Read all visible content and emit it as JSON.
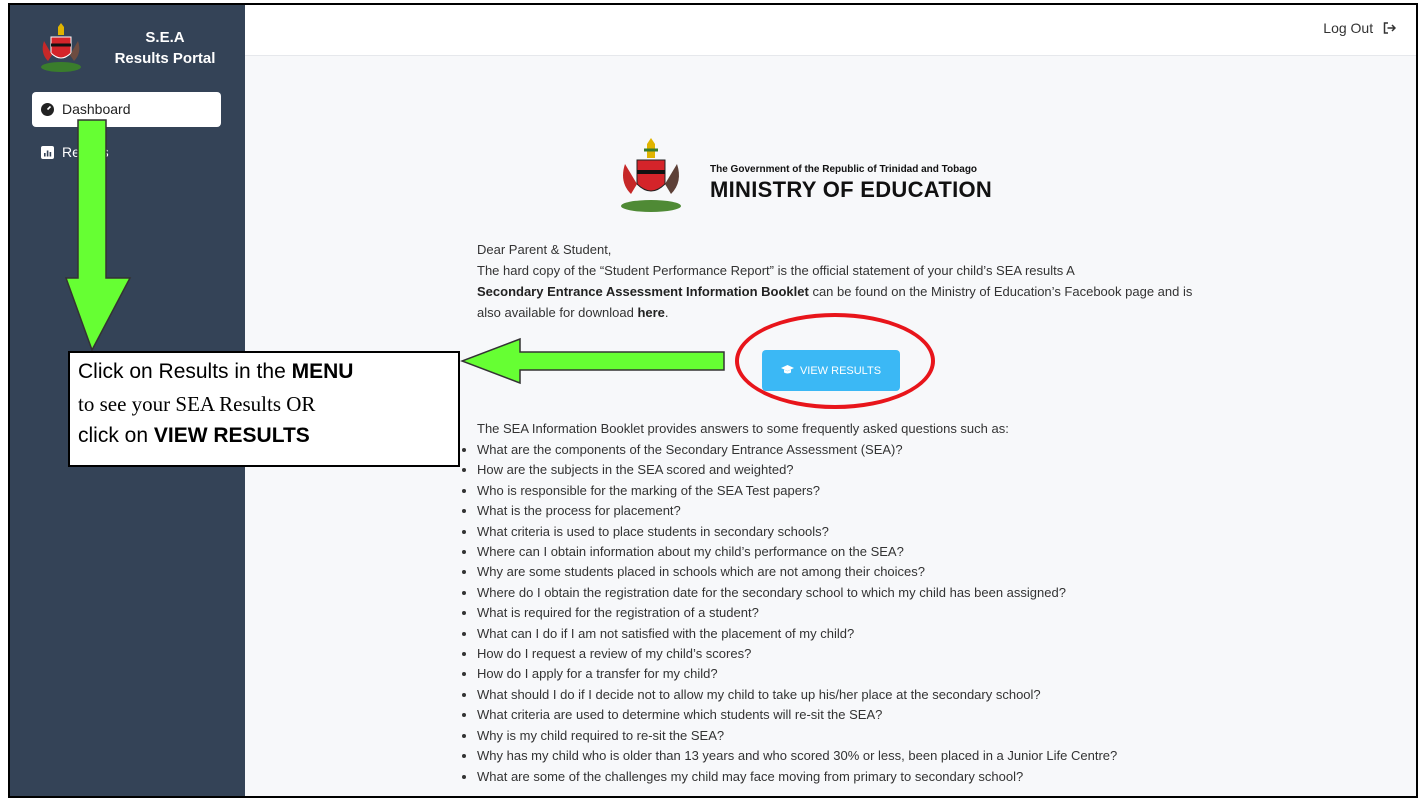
{
  "sidebar": {
    "brand_line1": "S.E.A",
    "brand_line2": "Results Portal",
    "items": [
      {
        "label": "Dashboard",
        "icon": "dashboard-icon",
        "active": true
      },
      {
        "label": "Results",
        "icon": "chart-icon",
        "active": false
      }
    ]
  },
  "topbar": {
    "logout_label": "Log Out",
    "logout_icon": "logout-icon"
  },
  "header": {
    "subtitle": "The Government of the Republic of Trinidad and Tobago",
    "title": "MINISTRY OF EDUCATION"
  },
  "letter": {
    "greeting": "Dear Parent & Student,",
    "p1": "The hard copy of the “Student Performance Report” is the official statement of your child’s SEA results  A",
    "booklet_bold": "Secondary Entrance Assessment Information Booklet",
    "p2": " can be found on the Ministry of Education’s Facebook page and is also available for download ",
    "here_link": "here",
    "p3": "."
  },
  "view_button": {
    "label": "VIEW RESULTS",
    "icon": "graduation-cap-icon"
  },
  "faq": {
    "intro": "The SEA Information Booklet provides answers to some frequently asked questions such as:",
    "items": [
      "What are the components of the Secondary Entrance Assessment (SEA)?",
      "How are the subjects in the SEA scored and weighted?",
      "Who is responsible for the marking of the SEA Test papers?",
      "What is the process for placement?",
      "What criteria is used to place students in secondary schools?",
      "Where can I obtain information about my child’s performance on the SEA?",
      "Why are some students placed in schools which are not among their choices?",
      "Where do I obtain the registration date for the secondary school to which my child has been assigned?",
      "What is required for the registration of a student?",
      "What can I do if I am not satisfied with the placement of my child?",
      "How do I request a review of my child’s scores?",
      "How do I apply for a transfer for my child?",
      "What should I do if I decide not to allow my child to take up his/her place at the secondary school?",
      "What criteria are used to determine which students will re-sit the SEA?",
      "Why is my child required to re-sit the SEA?",
      "Why has my child who is older than 13 years and who scored 30% or less, been placed in a Junior Life Centre?",
      "What are some of the challenges my child may face moving from primary to secondary school?"
    ]
  },
  "annotation": {
    "line1_a": "Click on Results in the ",
    "line1_b": "MENU",
    "line2": "to see your SEA Results OR",
    "line3_a": "click on ",
    "line3_b": "VIEW RESULTS",
    "arrow_color": "#66ff33",
    "circle_color": "#e8151b"
  }
}
